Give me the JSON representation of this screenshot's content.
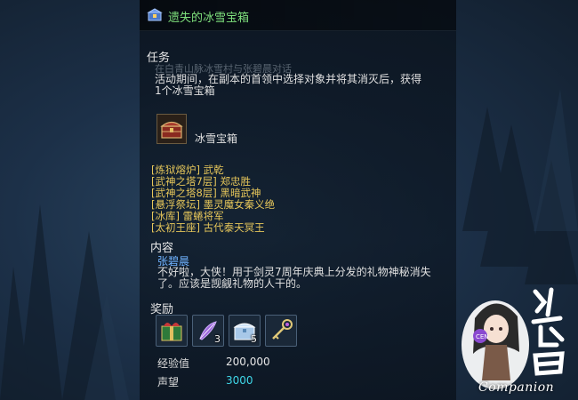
{
  "panel": {
    "title": "遗失的冰雪宝箱",
    "title_icon": "quest-chest-icon"
  },
  "task": {
    "heading": "任务",
    "faded_line": "在白青山脉冰雪村与张碧晨对话",
    "desc_line1": "活动期间，在副本的首领中选择对象并将其消灭后，获得",
    "desc_line2": "1个冰雪宝箱",
    "item_name": "冰雪宝箱",
    "item_icon": "treasure-chest-icon"
  },
  "locations": [
    "[炼狱熔炉] 武乾",
    "[武神之塔7层] 郑忠胜",
    "[武神之塔8层] 黑暗武神",
    "[悬浮祭坛] 墨灵魔女秦义绝",
    "[冰库] 雷蜷将军",
    "[太初王座] 古代泰天冥王"
  ],
  "content": {
    "heading": "内容",
    "npc": "张碧晨",
    "line1": "不好啦，大侠！用于剑灵7周年庆典上分发的礼物神秘消失",
    "line2": "了。应该是觊觎礼物的人干的。"
  },
  "rewards": {
    "heading": "奖励",
    "items": [
      {
        "icon": "gift-box-icon",
        "count": ""
      },
      {
        "icon": "purple-feather-icon",
        "count": "3"
      },
      {
        "icon": "ice-chest-icon",
        "count": "5"
      },
      {
        "icon": "key-icon",
        "count": ""
      }
    ],
    "exp_label": "经验值",
    "exp_value": "200,000",
    "rep_label": "声望",
    "rep_value": "3000"
  },
  "watermark": {
    "brand": "Companion",
    "badge": "CEN"
  },
  "colors": {
    "title": "#7ee07c",
    "location": "#e6c65a",
    "npc": "#6fb2ff",
    "reputation": "#3fd7e8"
  }
}
